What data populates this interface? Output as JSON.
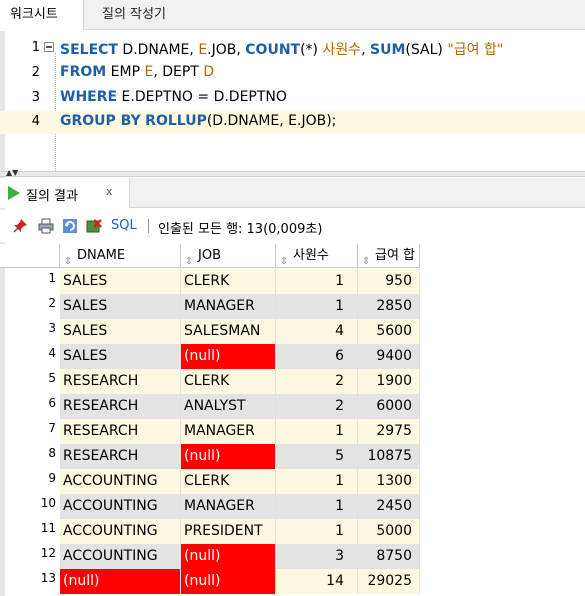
{
  "tabs": {
    "worksheet": "워크시트",
    "query_builder": "질의 작성기"
  },
  "editor": {
    "lines": [
      {
        "num": "1"
      },
      {
        "num": "2"
      },
      {
        "num": "3"
      },
      {
        "num": "4"
      }
    ],
    "line1": {
      "select": "SELECT",
      "t1": " D.DNAME, ",
      "ej": "E",
      "t2": ".JOB, ",
      "count": "COUNT",
      "t3": "(*) ",
      "a1": "사원수",
      "t4": ", ",
      "sum": "SUM",
      "t5": "(SAL) ",
      "a2": "\"급여 합\""
    },
    "line2": {
      "from": "FROM",
      "t1": " EMP ",
      "e": "E",
      "t2": ", DEPT ",
      "d": "D"
    },
    "line3": {
      "where": "WHERE",
      "t1": " E.DEPTNO = D.DEPTNO"
    },
    "line4": {
      "group": "GROUP BY",
      "t1": " ",
      "rollup": "ROLLUP",
      "t2": "(D.DNAME, E.JOB);"
    }
  },
  "result_tab": {
    "label": "질의 결과",
    "close": "x"
  },
  "toolbar": {
    "sql": "SQL",
    "status": "인출된 모든 행: 13(0,009초)"
  },
  "grid": {
    "headers": [
      "DNAME",
      "JOB",
      "사원수",
      "급여 합"
    ],
    "sort_glyph": "⇕",
    "rows": [
      {
        "n": "1",
        "dname": "SALES",
        "job": "CLERK",
        "cnt": "1",
        "sal": "950"
      },
      {
        "n": "2",
        "dname": "SALES",
        "job": "MANAGER",
        "cnt": "1",
        "sal": "2850"
      },
      {
        "n": "3",
        "dname": "SALES",
        "job": "SALESMAN",
        "cnt": "4",
        "sal": "5600"
      },
      {
        "n": "4",
        "dname": "SALES",
        "job": "(null)",
        "cnt": "6",
        "sal": "9400"
      },
      {
        "n": "5",
        "dname": "RESEARCH",
        "job": "CLERK",
        "cnt": "2",
        "sal": "1900"
      },
      {
        "n": "6",
        "dname": "RESEARCH",
        "job": "ANALYST",
        "cnt": "2",
        "sal": "6000"
      },
      {
        "n": "7",
        "dname": "RESEARCH",
        "job": "MANAGER",
        "cnt": "1",
        "sal": "2975"
      },
      {
        "n": "8",
        "dname": "RESEARCH",
        "job": "(null)",
        "cnt": "5",
        "sal": "10875"
      },
      {
        "n": "9",
        "dname": "ACCOUNTING",
        "job": "CLERK",
        "cnt": "1",
        "sal": "1300"
      },
      {
        "n": "10",
        "dname": "ACCOUNTING",
        "job": "MANAGER",
        "cnt": "1",
        "sal": "2450"
      },
      {
        "n": "11",
        "dname": "ACCOUNTING",
        "job": "PRESIDENT",
        "cnt": "1",
        "sal": "5000"
      },
      {
        "n": "12",
        "dname": "ACCOUNTING",
        "job": "(null)",
        "cnt": "3",
        "sal": "8750"
      },
      {
        "n": "13",
        "dname": "(null)",
        "job": "(null)",
        "cnt": "14",
        "sal": "29025"
      }
    ]
  },
  "colors": {
    "keyword": "#1f5fa8",
    "alias": "#b36a00",
    "null_bg": "#ff0000",
    "odd_row": "#fdf9e0",
    "even_row": "#e3e3e3"
  }
}
